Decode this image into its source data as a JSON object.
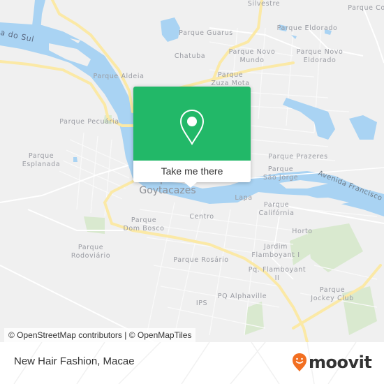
{
  "map": {
    "city_label": [
      "Campos dos",
      "Goytacazes"
    ],
    "river_label": "a do Sul",
    "road_label": "Avenida Francisco V",
    "places": [
      {
        "id": "silvestre",
        "lines": [
          "Silvestre"
        ]
      },
      {
        "id": "parque-co",
        "lines": [
          "Parque Co"
        ]
      },
      {
        "id": "parque-guarus",
        "lines": [
          "Parque Guarus"
        ]
      },
      {
        "id": "parque-eldorado",
        "lines": [
          "Parque Eldorado"
        ]
      },
      {
        "id": "chatuba",
        "lines": [
          "Chatuba"
        ]
      },
      {
        "id": "parque-novo-mundo",
        "lines": [
          "Parque Novo",
          "Mundo"
        ]
      },
      {
        "id": "parque-novo-eldorado",
        "lines": [
          "Parque Novo",
          "Eldorado"
        ]
      },
      {
        "id": "parque-aldeia",
        "lines": [
          "Parque Aldeia"
        ]
      },
      {
        "id": "parque-zuza-mota",
        "lines": [
          "Parque",
          "Zuza Mota"
        ]
      },
      {
        "id": "parque-pecuaria",
        "lines": [
          "Parque Pecuária"
        ]
      },
      {
        "id": "parque-esplanada",
        "lines": [
          "Parque",
          "Esplanada"
        ]
      },
      {
        "id": "parque-prazeres",
        "lines": [
          "Parque Prazeres"
        ]
      },
      {
        "id": "parque-sao-jorge",
        "lines": [
          "Parque",
          "São Jorge"
        ]
      },
      {
        "id": "lapa",
        "lines": [
          "Lapa"
        ]
      },
      {
        "id": "parque-california",
        "lines": [
          "Parque",
          "Califórnia"
        ]
      },
      {
        "id": "centro",
        "lines": [
          "Centro"
        ]
      },
      {
        "id": "parque-dom-bosco",
        "lines": [
          "Parque",
          "Dom Bosco"
        ]
      },
      {
        "id": "horto",
        "lines": [
          "Horto"
        ]
      },
      {
        "id": "parque-rodoviario",
        "lines": [
          "Parque",
          "Rodoviário"
        ]
      },
      {
        "id": "jardim-flamboyant-i",
        "lines": [
          "Jardim",
          "Flamboyant I"
        ]
      },
      {
        "id": "parque-rosario",
        "lines": [
          "Parque Rosário"
        ]
      },
      {
        "id": "pq-flamboyant-ii",
        "lines": [
          "Pq. Flamboyant",
          "II"
        ]
      },
      {
        "id": "parque-jockey-club",
        "lines": [
          "Parque",
          "Jockey Club"
        ]
      },
      {
        "id": "pq-alphaville",
        "lines": [
          "PQ Alphaville"
        ]
      },
      {
        "id": "ips",
        "lines": [
          "IPS"
        ]
      }
    ]
  },
  "popup": {
    "icon": "map-pin-icon",
    "button_label": "Take me there",
    "color": "#22b868"
  },
  "attribution": "© OpenStreetMap contributors | © OpenMapTiles",
  "footer": {
    "title": "New Hair Fashion, Macae",
    "logo_text": "moovit",
    "logo_color": "#f26f21"
  }
}
